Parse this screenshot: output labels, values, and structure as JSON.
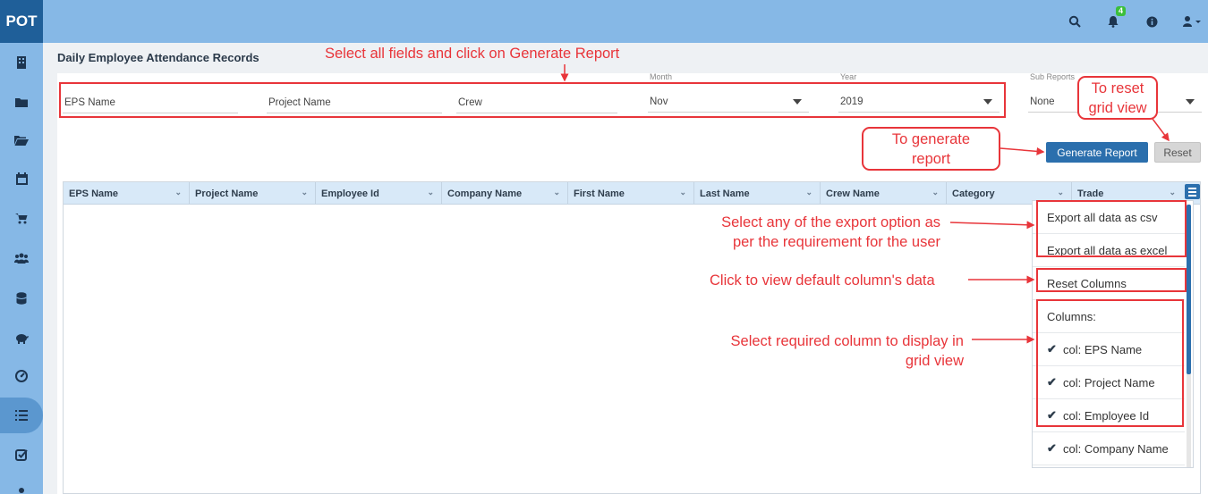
{
  "app": {
    "logo": "POT",
    "notification_count": "4"
  },
  "topbar_icons": [
    "search-icon",
    "bell-icon",
    "info-icon",
    "user-icon"
  ],
  "sidebar_icons": [
    "building-icon",
    "folder-icon",
    "folder-open-icon",
    "calendar-icon",
    "cart-icon",
    "users-icon",
    "database-icon",
    "piggy-bank-icon",
    "dashboard-icon",
    "list-icon",
    "checkbox-icon",
    "person-icon"
  ],
  "page": {
    "title": "Daily Employee Attendance Records"
  },
  "filters": {
    "eps_name": {
      "placeholder": "EPS Name"
    },
    "project_name": {
      "placeholder": "Project Name"
    },
    "crew": {
      "placeholder": "Crew"
    },
    "month": {
      "label": "Month",
      "value": "Nov"
    },
    "year": {
      "label": "Year",
      "value": "2019"
    },
    "sub_reports": {
      "label": "Sub Reports",
      "value": "None"
    }
  },
  "buttons": {
    "generate": "Generate Report",
    "reset": "Reset"
  },
  "grid": {
    "columns": [
      "EPS Name",
      "Project Name",
      "Employee Id",
      "Company Name",
      "First Name",
      "Last Name",
      "Crew Name",
      "Category",
      "Trade"
    ]
  },
  "column_menu": {
    "export_csv": "Export all data as csv",
    "export_excel": "Export all data as excel",
    "reset_columns": "Reset Columns",
    "columns_header": "Columns:",
    "columns": [
      "col: EPS Name",
      "col: Project Name",
      "col: Employee Id",
      "col: Company Name"
    ]
  },
  "annotations": {
    "select_fields": "Select all fields and click on Generate Report",
    "reset_grid_1": "To reset",
    "reset_grid_2": "grid view",
    "generate_1": "To generate",
    "generate_2": "report",
    "export_1": "Select any of the export option as",
    "export_2": "per the requirement for the user",
    "default_cols": "Click to view default column's data",
    "select_cols_1": "Select required column to display in",
    "select_cols_2": "grid view"
  },
  "colors": {
    "topbar": "#86b8e6",
    "primary": "#2b6fad",
    "annotation": "#e8353a"
  }
}
